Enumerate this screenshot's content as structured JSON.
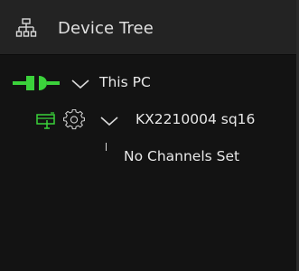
{
  "header": {
    "title": "Device Tree",
    "icon": "sitemap-icon"
  },
  "tree": {
    "root": {
      "label": "This PC",
      "icon": "connected-plug-icon",
      "expanded": true
    },
    "device": {
      "label": "KX2210004 sq16",
      "icons": [
        "usb-device-icon",
        "gear-icon"
      ],
      "expanded": true
    },
    "child": {
      "label": "No Channels Set"
    }
  },
  "colors": {
    "accent_green": "#3bd23b",
    "header_bg": "#232323",
    "panel_bg": "#131313"
  }
}
